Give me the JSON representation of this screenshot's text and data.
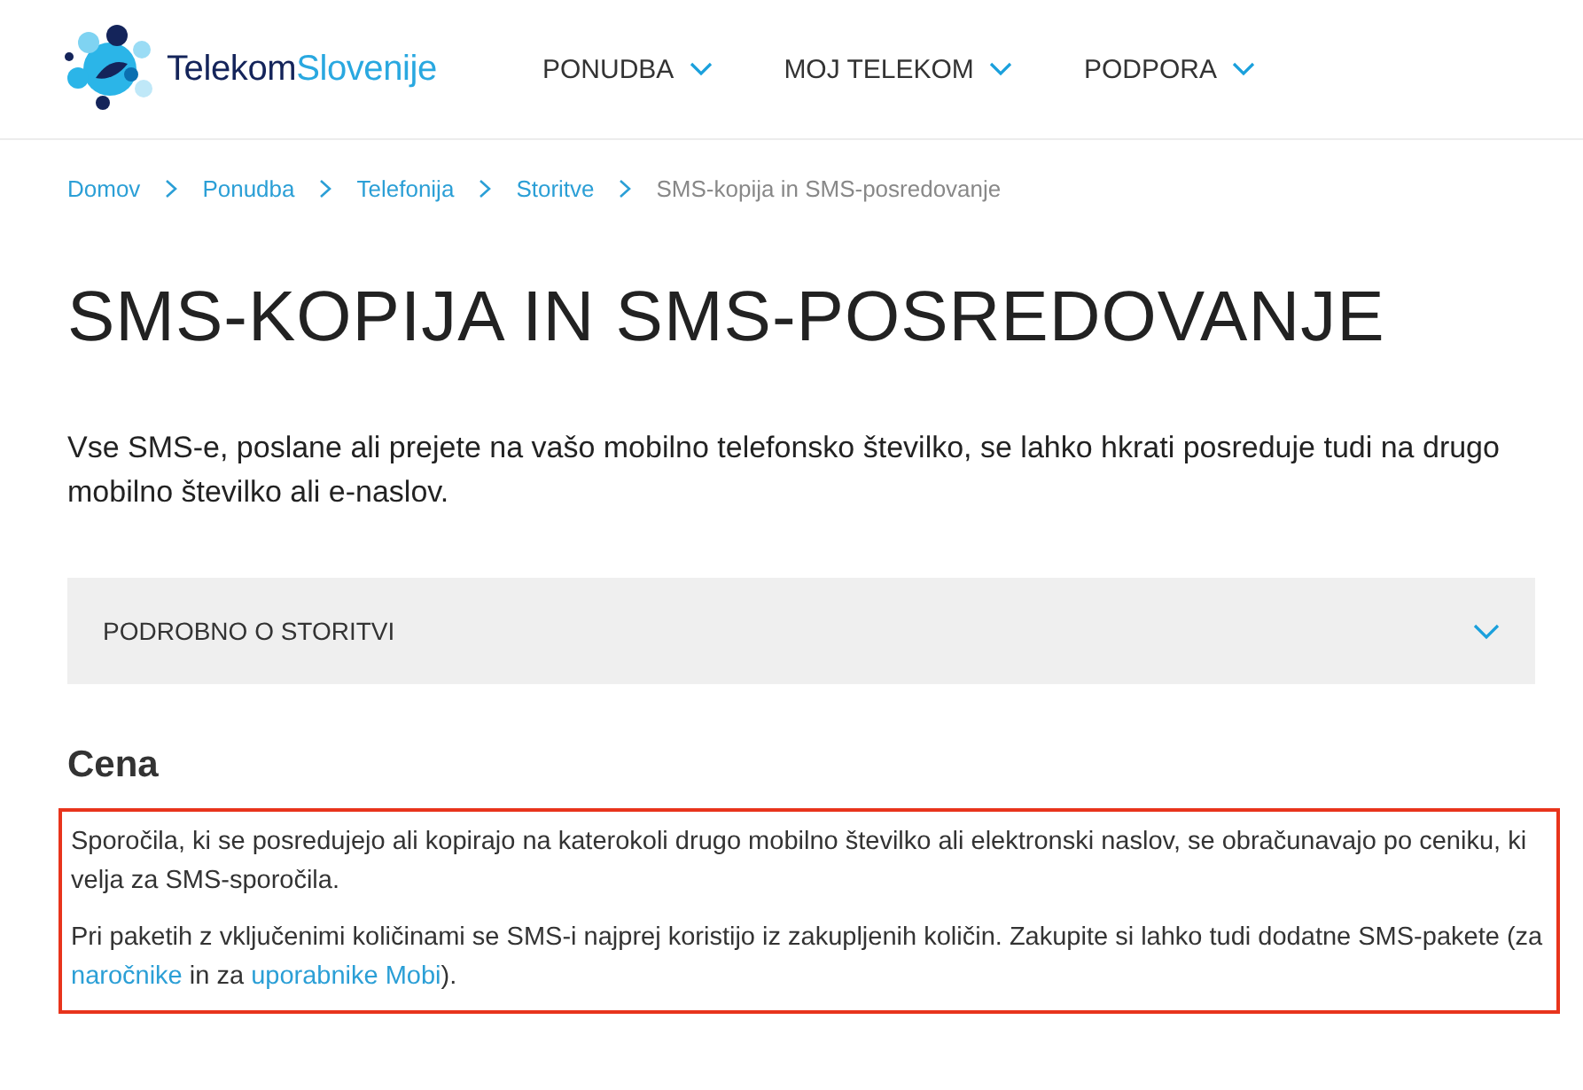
{
  "header": {
    "logo": {
      "part_1": "Telekom",
      "part_2": "Slovenije"
    },
    "nav": [
      {
        "label": "PONUDBA",
        "expanded": false
      },
      {
        "label": "MOJ TELEKOM",
        "expanded": false
      },
      {
        "label": "PODPORA",
        "expanded": false
      }
    ]
  },
  "breadcrumb": [
    {
      "label": "Domov",
      "kind": "link"
    },
    {
      "label": "Ponudba",
      "kind": "link"
    },
    {
      "label": "Telefonija",
      "kind": "link"
    },
    {
      "label": "Storitve",
      "kind": "link"
    },
    {
      "label": "SMS-kopija in SMS-posredovanje",
      "kind": "current"
    }
  ],
  "title": "SMS-KOPIJA IN SMS-POSREDOVANJE",
  "intro": "Vse SMS-e, poslane ali prejete na vašo mobilno telefonsko številko, se lahko hkrati posreduje tudi na drugo mobilno številko ali e-naslov.",
  "accordion": {
    "label": "PODROBNO O STORITVI",
    "expanded": false
  },
  "price": {
    "heading": "Cena",
    "highlighted": true,
    "paragraphs": [
      [
        {
          "kind": "text",
          "text": "Sporočila, ki se posredujejo ali kopirajo na katerokoli drugo mobilno številko ali elektronski naslov, se obračunavajo po ceniku, ki velja za SMS-sporočila."
        }
      ],
      [
        {
          "kind": "text",
          "text": "Pri paketih z vključenimi količinami se SMS-i najprej koristijo iz zakupljenih količin. Zakupite si lahko tudi dodatne SMS-pakete (za "
        },
        {
          "kind": "link",
          "text": "naročnike"
        },
        {
          "kind": "text",
          "text": " in za "
        },
        {
          "kind": "link",
          "text": "uporabnike Mobi"
        },
        {
          "kind": "text",
          "text": ")."
        }
      ]
    ]
  }
}
